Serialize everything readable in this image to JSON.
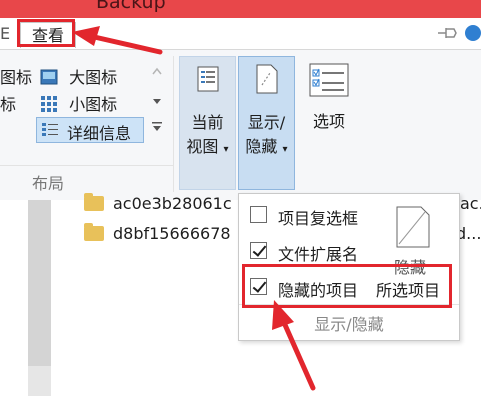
{
  "window": {
    "title": "Backup"
  },
  "tabs": {
    "prev_tab": "E",
    "view_tab": "查看"
  },
  "ribbon": {
    "layout": {
      "row1_left": "图标",
      "row1_right": "大图标",
      "row2_left": "标",
      "row2_right": "小图标",
      "row3_right": "详细信息",
      "group_label": "布局"
    },
    "current_view": {
      "line1": "当前",
      "line2": "视图"
    },
    "show_hide": {
      "line1": "显示/",
      "line2": "隐藏"
    },
    "options": {
      "label": "选项"
    }
  },
  "files": [
    {
      "name": "ac0e3b28061c",
      "tail": "ac."
    },
    {
      "name": "d8bf15666678",
      "tail": "d..."
    }
  ],
  "dropdown": {
    "items": [
      {
        "label": "项目复选框",
        "checked": false
      },
      {
        "label": "文件扩展名",
        "checked": true
      },
      {
        "label": "隐藏的项目",
        "checked": true
      }
    ],
    "hide_selected_top": "隐藏",
    "hide_selected_label": "所选项目",
    "footer": "显示/隐藏"
  },
  "colors": {
    "annotation": "#e2262d",
    "titlebar": "#e8474a",
    "selected_button": "#c8ddf2"
  }
}
